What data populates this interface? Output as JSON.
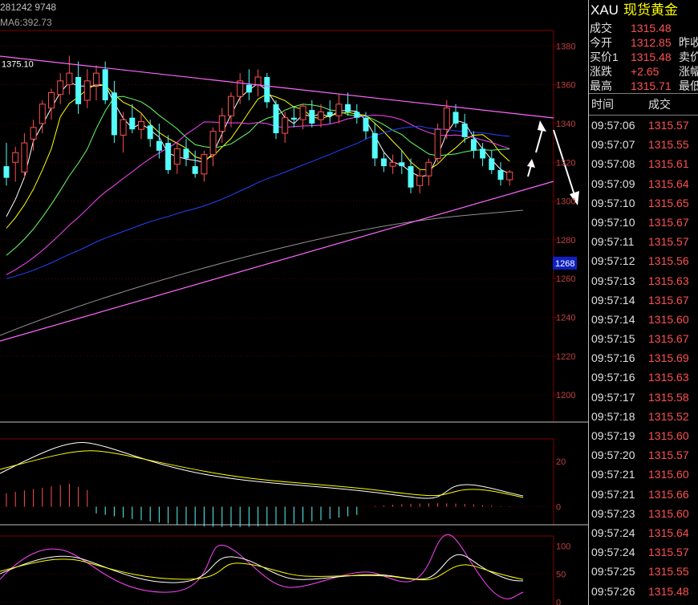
{
  "header": {
    "stats": "281242 9748",
    "indicator": "MA6:392.73"
  },
  "panel": {
    "symbol": "XAU",
    "name": "现货黄金",
    "quote": [
      {
        "label": "成交",
        "value": "1315.48",
        "extra": ""
      },
      {
        "label": "今开",
        "value": "1312.85",
        "extra": "昨收"
      },
      {
        "label": "买价1",
        "value": "1315.48",
        "extra": "卖价"
      },
      {
        "label": "涨跌",
        "value": "+2.65",
        "extra": "涨幅"
      },
      {
        "label": "最高",
        "value": "1315.71",
        "extra": "最低"
      }
    ],
    "ticks_header": {
      "time": "时间",
      "price": "成交"
    },
    "ticks": [
      {
        "time": "09:57:06",
        "price": "1315.57"
      },
      {
        "time": "09:57:07",
        "price": "1315.55"
      },
      {
        "time": "09:57:08",
        "price": "1315.61"
      },
      {
        "time": "09:57:09",
        "price": "1315.64"
      },
      {
        "time": "09:57:10",
        "price": "1315.65"
      },
      {
        "time": "09:57:10",
        "price": "1315.67"
      },
      {
        "time": "09:57:11",
        "price": "1315.57"
      },
      {
        "time": "09:57:12",
        "price": "1315.56"
      },
      {
        "time": "09:57:13",
        "price": "1315.63"
      },
      {
        "time": "09:57:14",
        "price": "1315.67"
      },
      {
        "time": "09:57:14",
        "price": "1315.60"
      },
      {
        "time": "09:57:15",
        "price": "1315.67"
      },
      {
        "time": "09:57:16",
        "price": "1315.69"
      },
      {
        "time": "09:57:16",
        "price": "1315.63"
      },
      {
        "time": "09:57:17",
        "price": "1315.58"
      },
      {
        "time": "09:57:18",
        "price": "1315.52"
      },
      {
        "time": "09:57:19",
        "price": "1315.60"
      },
      {
        "time": "09:57:20",
        "price": "1315.57"
      },
      {
        "time": "09:57:21",
        "price": "1315.60"
      },
      {
        "time": "09:57:21",
        "price": "1315.66"
      },
      {
        "time": "09:57:23",
        "price": "1315.60"
      },
      {
        "time": "09:57:24",
        "price": "1315.64"
      },
      {
        "time": "09:57:24",
        "price": "1315.57"
      },
      {
        "time": "09:57:25",
        "price": "1315.55"
      },
      {
        "time": "09:57:26",
        "price": "1315.48"
      }
    ]
  },
  "chart_data": {
    "type": "candlestick",
    "price_axis": {
      "ticks": [
        "1380",
        "1360",
        "1340",
        "1320",
        "1300",
        "1280",
        "1260",
        "1240",
        "1220",
        "1200"
      ],
      "ylim": [
        1186,
        1388
      ],
      "current_label": "1268",
      "high_label": "1375.10"
    },
    "macd_axis": {
      "ticks": [
        "20",
        "0"
      ],
      "ylim": [
        -8,
        30
      ]
    },
    "kdj_axis": {
      "ticks": [
        "100",
        "50",
        "0"
      ],
      "ylim": [
        -5,
        118
      ]
    },
    "candles": [
      [
        1318,
        1330,
        1308,
        1312
      ],
      [
        1320,
        1328,
        1310,
        1325
      ],
      [
        1315,
        1335,
        1312,
        1330
      ],
      [
        1332,
        1342,
        1326,
        1338
      ],
      [
        1340,
        1352,
        1335,
        1350
      ],
      [
        1348,
        1358,
        1342,
        1356
      ],
      [
        1355,
        1366,
        1350,
        1362
      ],
      [
        1360,
        1375,
        1355,
        1366
      ],
      [
        1364,
        1372,
        1345,
        1350
      ],
      [
        1352,
        1368,
        1348,
        1362
      ],
      [
        1360,
        1370,
        1352,
        1366
      ],
      [
        1368,
        1372,
        1350,
        1352
      ],
      [
        1356,
        1362,
        1330,
        1334
      ],
      [
        1334,
        1346,
        1325,
        1342
      ],
      [
        1343,
        1350,
        1335,
        1337
      ],
      [
        1337,
        1345,
        1332,
        1341
      ],
      [
        1339,
        1342,
        1328,
        1332
      ],
      [
        1331,
        1340,
        1322,
        1326
      ],
      [
        1330,
        1334,
        1314,
        1316
      ],
      [
        1319,
        1330,
        1314,
        1327
      ],
      [
        1327,
        1332,
        1318,
        1322
      ],
      [
        1318,
        1326,
        1312,
        1314
      ],
      [
        1314,
        1326,
        1310,
        1324
      ],
      [
        1324,
        1338,
        1318,
        1336
      ],
      [
        1336,
        1348,
        1330,
        1344
      ],
      [
        1344,
        1356,
        1338,
        1354
      ],
      [
        1354,
        1366,
        1350,
        1362
      ],
      [
        1360,
        1368,
        1352,
        1356
      ],
      [
        1360,
        1368,
        1354,
        1364
      ],
      [
        1364,
        1366,
        1348,
        1351
      ],
      [
        1350,
        1352,
        1332,
        1335
      ],
      [
        1335,
        1346,
        1330,
        1343
      ],
      [
        1343,
        1349,
        1338,
        1342
      ],
      [
        1342,
        1350,
        1337,
        1349
      ],
      [
        1347,
        1352,
        1338,
        1340
      ],
      [
        1342,
        1350,
        1338,
        1346
      ],
      [
        1346,
        1352,
        1340,
        1344
      ],
      [
        1344,
        1355,
        1340,
        1350
      ],
      [
        1350,
        1356,
        1344,
        1346
      ],
      [
        1346,
        1350,
        1340,
        1343
      ],
      [
        1343,
        1346,
        1332,
        1336
      ],
      [
        1335,
        1340,
        1318,
        1322
      ],
      [
        1322,
        1325,
        1315,
        1318
      ],
      [
        1318,
        1324,
        1314,
        1320
      ],
      [
        1320,
        1326,
        1314,
        1318
      ],
      [
        1318,
        1322,
        1304,
        1307
      ],
      [
        1308,
        1316,
        1304,
        1313
      ],
      [
        1313,
        1322,
        1308,
        1320
      ],
      [
        1322,
        1340,
        1320,
        1337
      ],
      [
        1337,
        1352,
        1332,
        1348
      ],
      [
        1346,
        1350,
        1338,
        1340
      ],
      [
        1340,
        1345,
        1330,
        1333
      ],
      [
        1332,
        1336,
        1322,
        1326
      ],
      [
        1327,
        1330,
        1318,
        1322
      ],
      [
        1322,
        1326,
        1314,
        1316
      ],
      [
        1316,
        1320,
        1308,
        1311
      ],
      [
        1311,
        1316,
        1308,
        1315
      ]
    ]
  }
}
